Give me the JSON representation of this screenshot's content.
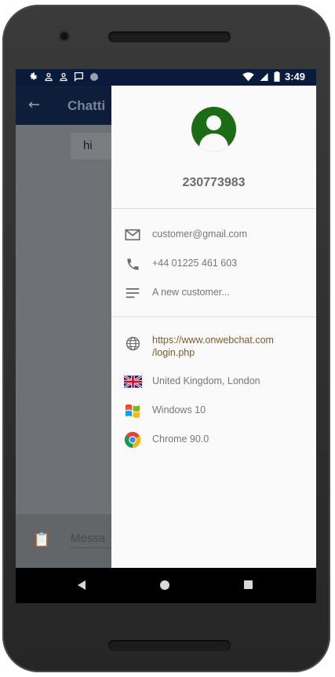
{
  "status_bar": {
    "time": "3:49",
    "left_icons": [
      "gear-icon",
      "person-icon",
      "person-icon",
      "message-icon",
      "circle-icon"
    ],
    "right_icons": [
      "wifi-icon",
      "signal-icon",
      "battery-icon"
    ]
  },
  "toolbar": {
    "title": "Chatti",
    "back_icon": "arrow-back-icon"
  },
  "chat": {
    "message": "hi"
  },
  "composer": {
    "placeholder": "Messa"
  },
  "drawer": {
    "avatar_icon": "account-circle-icon",
    "username": "230773983",
    "contact_rows": [
      {
        "icon": "email-icon",
        "text": "customer@gmail.com"
      },
      {
        "icon": "phone-icon",
        "text": "+44 01225 461 603"
      },
      {
        "icon": "notes-icon",
        "text": "A new customer..."
      }
    ],
    "visit": {
      "url_line1": "https://www.onwebchat.com",
      "url_line2": "/login.php",
      "location": "United Kingdom, London",
      "os": "Windows 10",
      "browser": "Chrome 90.0"
    },
    "accent_color": "#1b6b17",
    "link_color": "#7a5a2b"
  },
  "nav_bar": [
    "back-icon",
    "home-icon",
    "recents-icon"
  ]
}
